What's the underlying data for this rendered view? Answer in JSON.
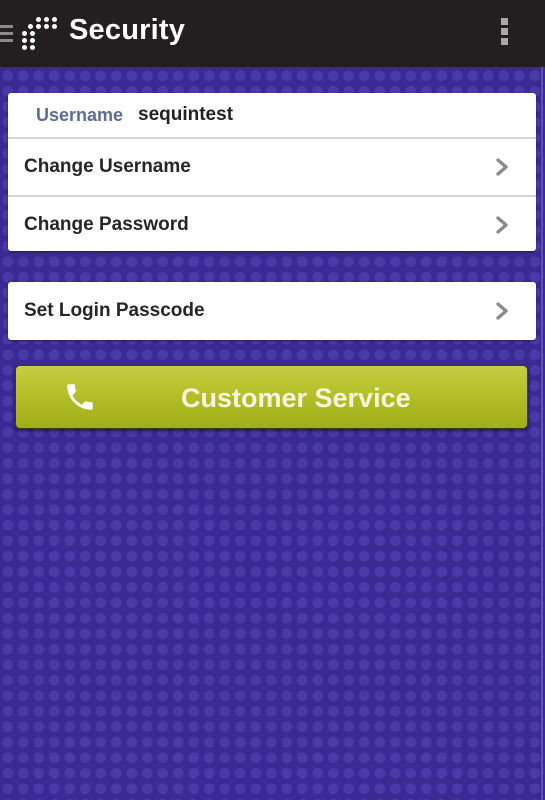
{
  "app_bar": {
    "title": "Security",
    "nav_icon": "hamburger-menu-icon",
    "logo_icon": "dot-grid-logo-icon",
    "overflow_icon": "overflow-menu-icon"
  },
  "account": {
    "username_label": "Username",
    "username_value": "sequintest"
  },
  "menu_items": [
    {
      "label": "Change Username",
      "icon": "chevron-right-icon"
    },
    {
      "label": "Change Password",
      "icon": "chevron-right-icon"
    }
  ],
  "passcode_item": {
    "label": "Set Login Passcode",
    "icon": "chevron-right-icon"
  },
  "customer_service": {
    "label": "Customer Service",
    "icon": "phone-icon"
  },
  "colors": {
    "app_bar": "#231f20",
    "background": "#3b2a94",
    "button_green": "#b5c028",
    "username_label": "#5c6c96"
  }
}
